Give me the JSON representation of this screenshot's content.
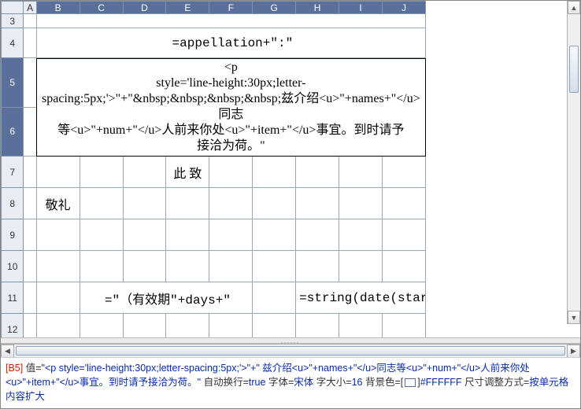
{
  "columns": [
    "A",
    "B",
    "C",
    "D",
    "E",
    "F",
    "G",
    "H",
    "I",
    "J"
  ],
  "rows": [
    "3",
    "4",
    "5",
    "6",
    "7",
    "8",
    "9",
    "10",
    "11",
    "12"
  ],
  "selected_cols": [
    "B",
    "C",
    "D",
    "E",
    "F",
    "G",
    "H",
    "I",
    "J"
  ],
  "selected_rows": [
    "5",
    "6"
  ],
  "cells": {
    "r4": "=appellation+\":\"",
    "r5body_l1": "<p",
    "r5body_l2": "style='line-height:30px;letter-spacing:5px;'>\"+\"&nbsp;&nbsp;&nbsp;&nbsp;兹介绍<u>\"+names+\"</u>同志",
    "r6body_l1": "等<u>\"+num+\"</u>人前来你处<u>\"+item+\"</u>事宜。到时请予",
    "r6body_l2": "接洽为荷。\"",
    "r7_E": "此 致",
    "r8_B": "敬礼",
    "r11_C": "=\"（有效期\"+days+\"",
    "r11_H": "=string(date(start)"
  },
  "status": {
    "cellref": "[B5]",
    "label_value": "值=",
    "value_text": "\"<p style='line-height:30px;letter-spacing:5px;'>\"+\"    兹介绍<u>\"+names+\"</u>同志等<u>\"+num+\"</u>人前来你处<u>\"+item+\"</u>事宜。到时请予接洽为荷。\"",
    "label_wrap": "自动换行=",
    "wrap": "true",
    "label_font": "字体=",
    "font": "宋体",
    "label_fontsize": "字大小=",
    "fontsize": "16",
    "label_bg": "背景色=[",
    "label_bg_close": "]",
    "bg_hex": "#FFFFFF",
    "label_resize": "尺寸调整方式=",
    "resize": "按单元格内容扩大"
  },
  "col_widths": {
    "A": 16,
    "B": 54,
    "C": 54,
    "D": 54,
    "E": 54,
    "F": 54,
    "G": 54,
    "H": 54,
    "I": 54,
    "J": 54
  }
}
